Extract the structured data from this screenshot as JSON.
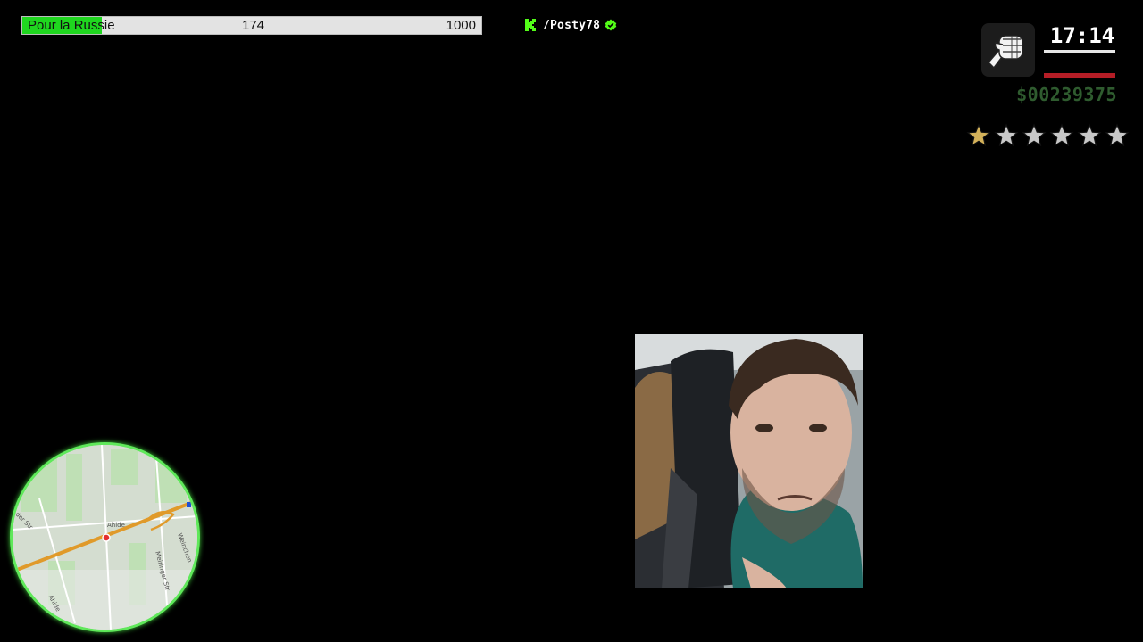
{
  "donation_goal": {
    "label": "Pour la Russie",
    "current": "174",
    "target": "1000",
    "progress_fraction": 0.174,
    "fill_color": "#1fd61f"
  },
  "channel": {
    "platform_icon": "kick-logo-icon",
    "name": "/Posty78",
    "verified_icon": "verified-badge-icon",
    "accent": "#53fc18"
  },
  "hud": {
    "weapon_icon": "fist-icon",
    "time": "17:14",
    "money": "$00239375",
    "health_color": "#b51d26",
    "money_color": "#2f5c2f",
    "wanted_level": 1,
    "wanted_max": 6
  },
  "minimap": {
    "street_labels": [
      "Ahide",
      "Ahide",
      "der Str",
      "Meiringer Str",
      "Weinchen"
    ],
    "border_color": "#5fe85a"
  },
  "webcam": {
    "description_icon": "webcam-feed"
  }
}
